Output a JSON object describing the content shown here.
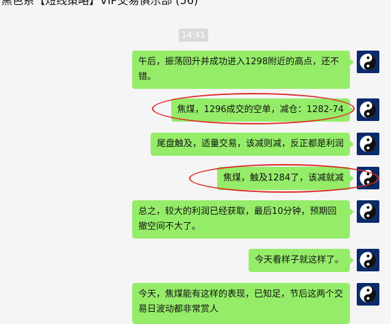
{
  "window": {
    "title": "黑色系【短线策略】VIP交易俱乐部 (56)",
    "more_label": "···"
  },
  "chat": {
    "timestamp": "14:41",
    "messages": [
      {
        "text": "午后，振荡回升并成功进入1298附近的高点，还不错。"
      },
      {
        "text": "焦煤，1296成交的空单，减仓：1282-74"
      },
      {
        "text": "尾盘触及，适量交易，该减则减，反正都是利润"
      },
      {
        "text": "焦煤，触及1284了，该减就减"
      },
      {
        "text": "总之，较大的利润已经获取，最后10分钟，预期回撤空间不大了。"
      },
      {
        "text": "今天看样子就这样了。"
      },
      {
        "text": "今天，焦煤能有这样的表现，已知足，节后这两个交易日波动都非常赏人"
      }
    ],
    "avatar_icon": "yin-yang-icon",
    "colors": {
      "bubble": "#95ec69",
      "highlight": "#e02a2a",
      "avatar_bg": "#0a2a6b"
    }
  }
}
